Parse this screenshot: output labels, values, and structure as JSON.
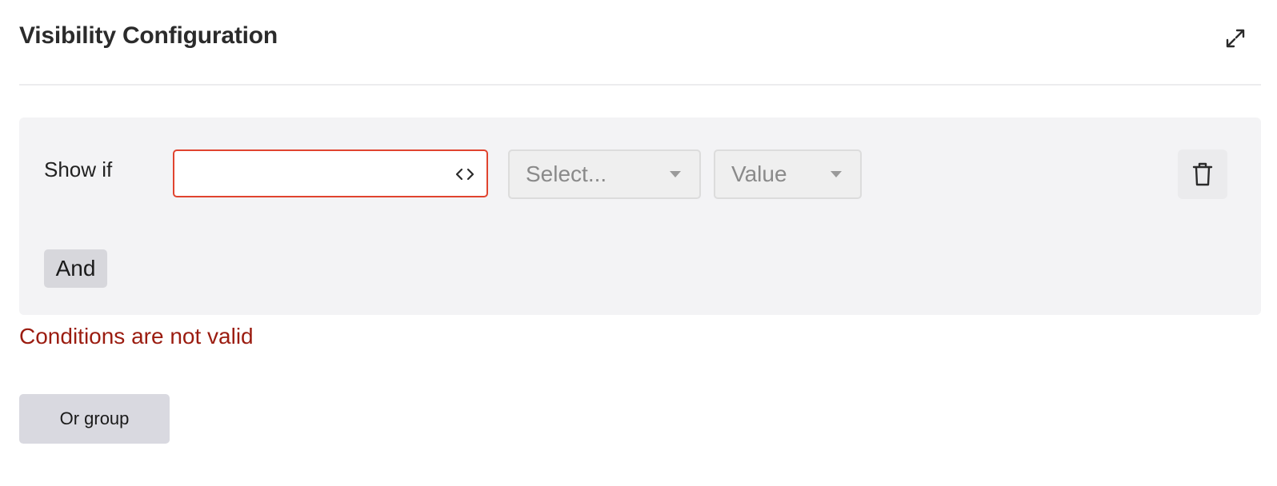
{
  "header": {
    "title": "Visibility Configuration",
    "expand_icon": "expand-arrows-icon"
  },
  "condition_group": {
    "show_if_label": "Show if",
    "field_input": {
      "value": "",
      "placeholder": "",
      "state": "invalid",
      "icon": "code-brackets-icon"
    },
    "operator_select": {
      "placeholder": "Select...",
      "icon": "caret-down-icon"
    },
    "value_select": {
      "placeholder": "Value",
      "icon": "caret-down-icon"
    },
    "delete_icon": "trash-icon",
    "and_button_label": "And"
  },
  "validation": {
    "error_message": "Conditions are not valid"
  },
  "footer": {
    "or_group_label": "Or group"
  },
  "colors": {
    "error_border": "#e0442f",
    "error_text": "#9b1c10",
    "panel_bg": "#f3f3f5",
    "button_bg": "#d9d9e0"
  }
}
